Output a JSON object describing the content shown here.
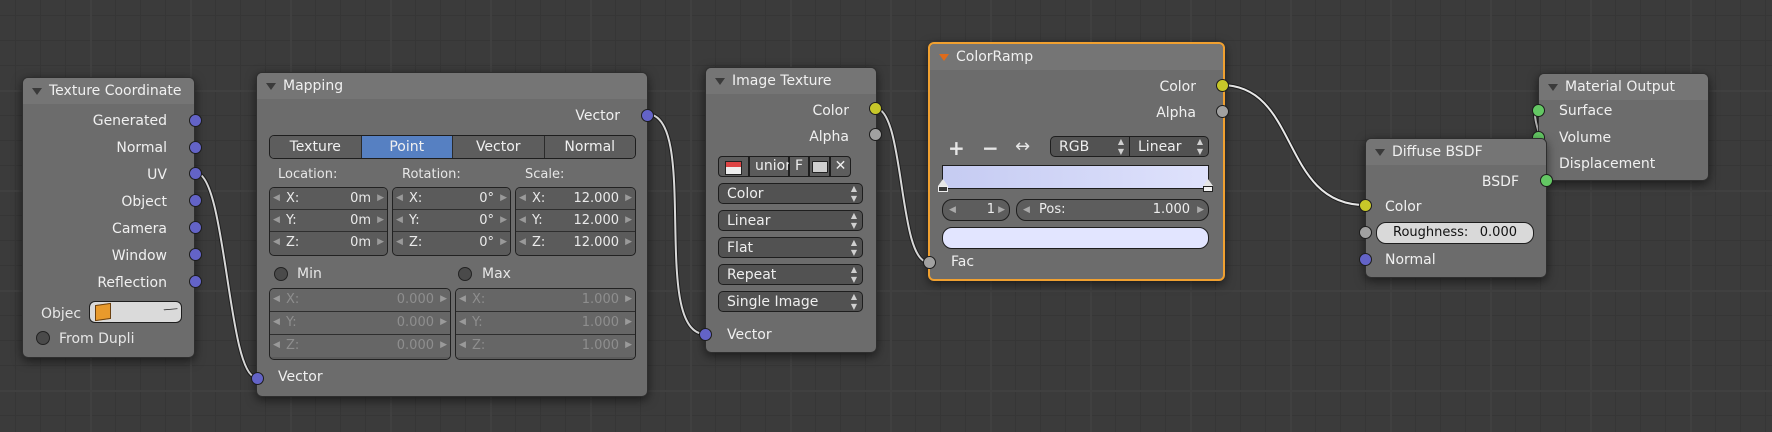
{
  "texture_coordinate": {
    "title": "Texture Coordinate",
    "outputs": [
      "Generated",
      "Normal",
      "UV",
      "Object",
      "Camera",
      "Window",
      "Reflection"
    ],
    "object_label": "Objec",
    "from_dupli_label": "From Dupli"
  },
  "mapping": {
    "title": "Mapping",
    "output_vector": "Vector",
    "tabs": [
      "Texture",
      "Point",
      "Vector",
      "Normal"
    ],
    "selected_tab": "Point",
    "location_label": "Location:",
    "rotation_label": "Rotation:",
    "scale_label": "Scale:",
    "location": [
      {
        "axis": "X:",
        "value": "0m"
      },
      {
        "axis": "Y:",
        "value": "0m"
      },
      {
        "axis": "Z:",
        "value": "0m"
      }
    ],
    "rotation": [
      {
        "axis": "X:",
        "value": "0°"
      },
      {
        "axis": "Y:",
        "value": "0°"
      },
      {
        "axis": "Z:",
        "value": "0°"
      }
    ],
    "scale": [
      {
        "axis": "X:",
        "value": "12.000"
      },
      {
        "axis": "Y:",
        "value": "12.000"
      },
      {
        "axis": "Z:",
        "value": "12.000"
      }
    ],
    "min_label": "Min",
    "max_label": "Max",
    "min": [
      {
        "axis": "X:",
        "value": "0.000"
      },
      {
        "axis": "Y:",
        "value": "0.000"
      },
      {
        "axis": "Z:",
        "value": "0.000"
      }
    ],
    "max": [
      {
        "axis": "X:",
        "value": "1.000"
      },
      {
        "axis": "Y:",
        "value": "1.000"
      },
      {
        "axis": "Z:",
        "value": "1.000"
      }
    ],
    "input_vector": "Vector"
  },
  "image_texture": {
    "title": "Image Texture",
    "outputs": [
      "Color",
      "Alpha"
    ],
    "image_name": "union",
    "fake_user": "F",
    "dropdowns": [
      "Color",
      "Linear",
      "Flat",
      "Repeat",
      "Single Image"
    ],
    "input_vector": "Vector"
  },
  "color_ramp": {
    "title": "ColorRamp",
    "outputs": [
      "Color",
      "Alpha"
    ],
    "add_symbol": "+",
    "remove_symbol": "−",
    "flip_symbol": "↔",
    "color_mode": "RGB",
    "interpolation": "Linear",
    "stop_index": "1",
    "pos_label": "Pos:",
    "pos_value": "1.000",
    "input_fac": "Fac",
    "gradient_start_color": "#c5cbf2",
    "gradient_end_color": "#dfe2fc",
    "stop_color": "#e2e5ff"
  },
  "diffuse_bsdf": {
    "title": "Diffuse BSDF",
    "output": "BSDF",
    "input_color": "Color",
    "roughness_label": "Roughness:",
    "roughness_value": "0.000",
    "input_normal": "Normal"
  },
  "material_output": {
    "title": "Material Output",
    "inputs": [
      "Surface",
      "Volume",
      "Displacement"
    ]
  },
  "colors": {
    "vector_socket": "#6363c7",
    "color_socket": "#c7c729",
    "float_socket": "#a1a1a1",
    "shader_socket": "#63c763",
    "active_border": "#f0a030",
    "tab_selected": "#5680c2"
  }
}
